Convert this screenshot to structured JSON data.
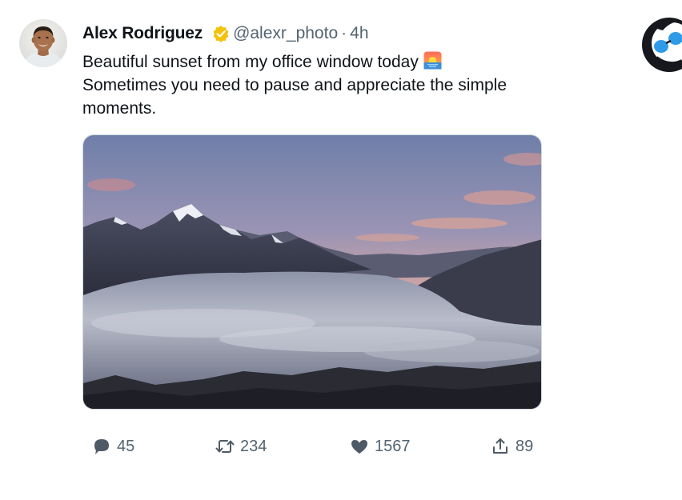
{
  "tweet": {
    "author": {
      "name": "Alex Rodriguez",
      "handle": "@alexr_photo",
      "verified": true
    },
    "separator": "·",
    "time": "4h",
    "text_lines": [
      "Beautiful sunset from my office window today",
      "Sometimes you need to pause and appreciate the simple",
      "moments."
    ],
    "emoji": "sunrise-emoji",
    "media": {
      "description_icon": "photo"
    },
    "actions": {
      "reply_count": "45",
      "retweet_count": "234",
      "like_count": "1567",
      "share_count": "89"
    }
  },
  "colors": {
    "text_primary": "#0f1419",
    "text_secondary": "#536471",
    "verified_badge": "#f4c20d",
    "border": "#cfd9de"
  },
  "icons": {
    "reply": "speech-bubble-icon",
    "retweet": "retweet-arrows-icon",
    "like": "heart-icon",
    "share": "share-upload-icon",
    "verified": "verified-badge-icon",
    "corner": "bird-mascot-logo"
  }
}
